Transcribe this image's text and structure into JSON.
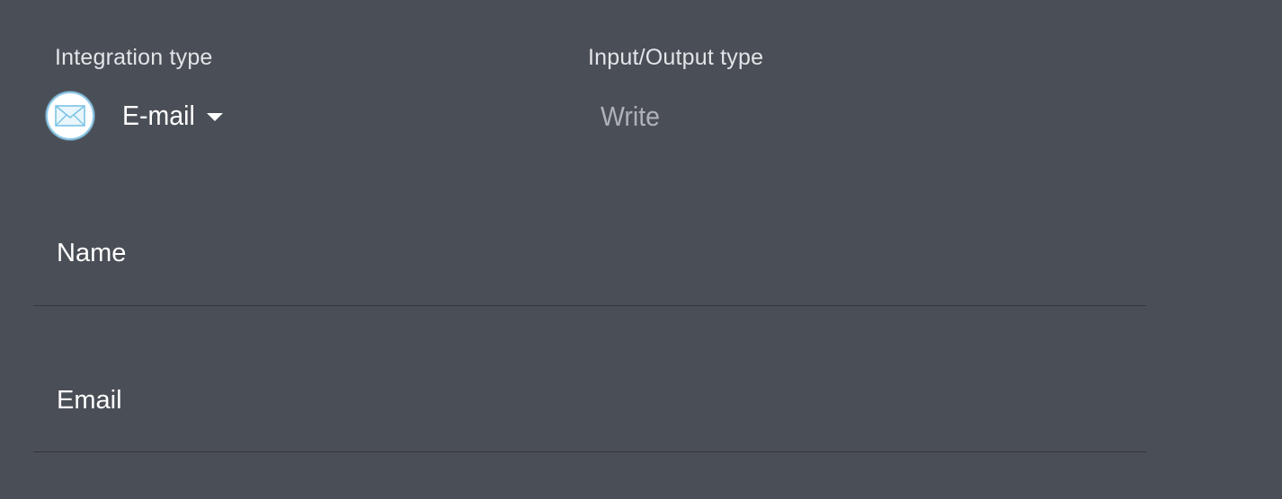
{
  "integration": {
    "label": "Integration type",
    "icon": "email-envelope-icon",
    "selected_value": "E-mail"
  },
  "io": {
    "label": "Input/Output type",
    "value": "Write"
  },
  "fields": {
    "name": {
      "label": "Name",
      "value": ""
    },
    "email": {
      "label": "Email",
      "value": ""
    }
  },
  "colors": {
    "background": "#4a4e56",
    "icon_border": "#8cc9e8",
    "muted_text": "#aeb1b6",
    "divider": "#33363c"
  }
}
